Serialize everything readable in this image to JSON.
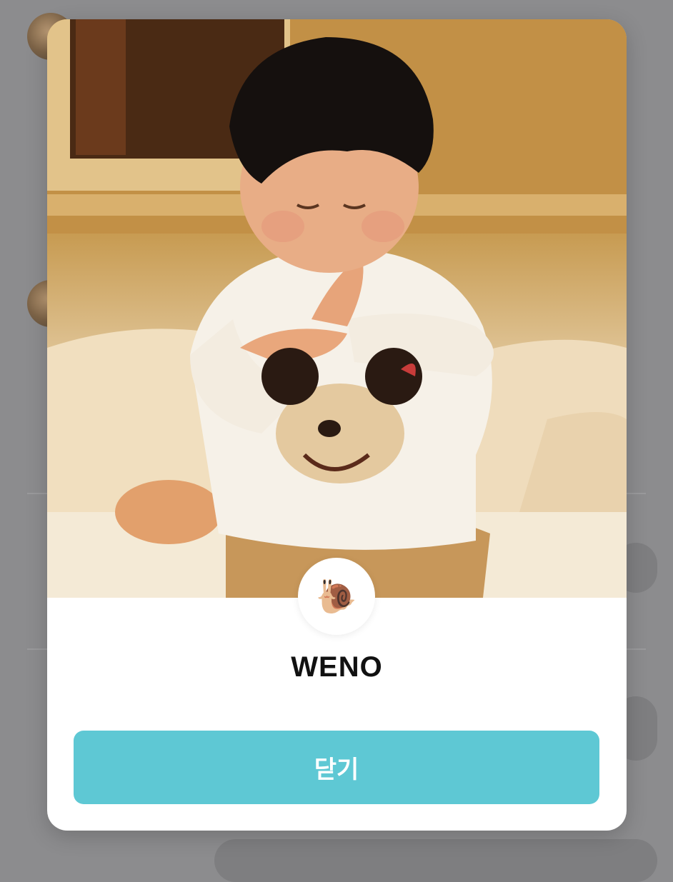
{
  "profile": {
    "name": "WENO",
    "emoji": "🐌",
    "emoji_icon": "snail-icon"
  },
  "actions": {
    "close_label": "닫기"
  },
  "colors": {
    "close_button": "#5ec8d4",
    "overlay": "#8c8c8e"
  }
}
